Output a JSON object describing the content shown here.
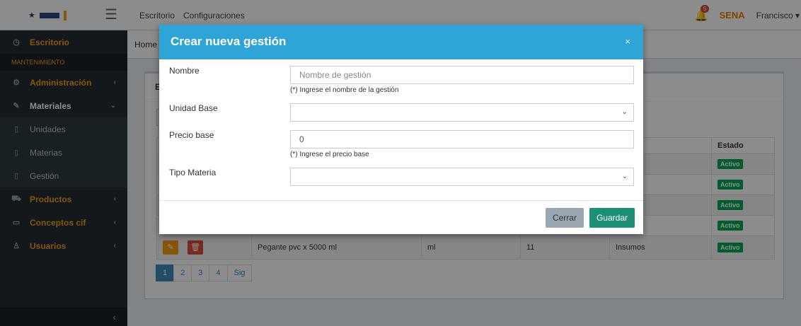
{
  "topbar": {
    "menu": [
      "Escritorio",
      "Configuraciones"
    ],
    "notification_count": "5",
    "brand": "SENA",
    "user": "Francisco"
  },
  "breadcrumb": "Home",
  "sidebar": {
    "items": [
      {
        "label": "Escritorio",
        "style": "orange",
        "icon": "dashboard-icon"
      },
      {
        "label": "MANTENIMIENTO",
        "style": "header"
      },
      {
        "label": "Administración",
        "style": "orange",
        "icon": "gear-icon",
        "arrow": true
      },
      {
        "label": "Materiales",
        "style": "white",
        "icon": "wrench-icon",
        "arrow": true
      },
      {
        "label": "Unidades",
        "style": "sub",
        "icon": "file-icon"
      },
      {
        "label": "Materias",
        "style": "sub",
        "icon": "file-icon"
      },
      {
        "label": "Gestión",
        "style": "sub",
        "icon": "file-icon"
      },
      {
        "label": "Productos",
        "style": "orange",
        "icon": "cart-icon",
        "arrow": true
      },
      {
        "label": "Conceptos cif",
        "style": "orange",
        "icon": "tag-icon",
        "arrow": true
      },
      {
        "label": "Usuarios",
        "style": "orange",
        "icon": "user-icon",
        "arrow": true
      }
    ]
  },
  "box": {
    "title_initial": "E"
  },
  "table": {
    "headers": [
      "",
      "",
      "",
      "",
      "ateria",
      "Estado"
    ],
    "rows": [
      {
        "nombre": "",
        "unidad": "",
        "precio": "",
        "materia": "s",
        "estado": "Activo"
      },
      {
        "nombre": "",
        "unidad": "",
        "precio": "",
        "materia": "s",
        "estado": "Activo"
      },
      {
        "nombre": "",
        "unidad": "",
        "precio": "",
        "materia": "s",
        "estado": "Activo"
      },
      {
        "nombre": "",
        "unidad": "",
        "precio": "",
        "materia": "s",
        "estado": "Activo"
      },
      {
        "nombre": "Pegante pvc x 5000 ml",
        "unidad": "ml",
        "precio": "11",
        "materia": "Insumos",
        "estado": "Activo"
      }
    ]
  },
  "pager": [
    "1",
    "2",
    "3",
    "4",
    "Sig"
  ],
  "modal": {
    "title": "Crear nueva gestión",
    "close": "×",
    "fields": {
      "nombre_label": "Nombre",
      "nombre_placeholder": "Nombre de gestión",
      "nombre_help": "(*) Ingrese el nombre de la gestión",
      "unidad_label": "Unidad Base",
      "precio_label": "Precio base",
      "precio_value": "0",
      "precio_help": "(*) Ingrese el precio base",
      "tipo_label": "Tipo Materia"
    },
    "buttons": {
      "close": "Cerrar",
      "save": "Guardar"
    }
  },
  "colors": {
    "modal_header": "#2fa4d6",
    "save_button": "#1e8f77",
    "sidebar": "#222d32",
    "accent": "#f39c12"
  }
}
